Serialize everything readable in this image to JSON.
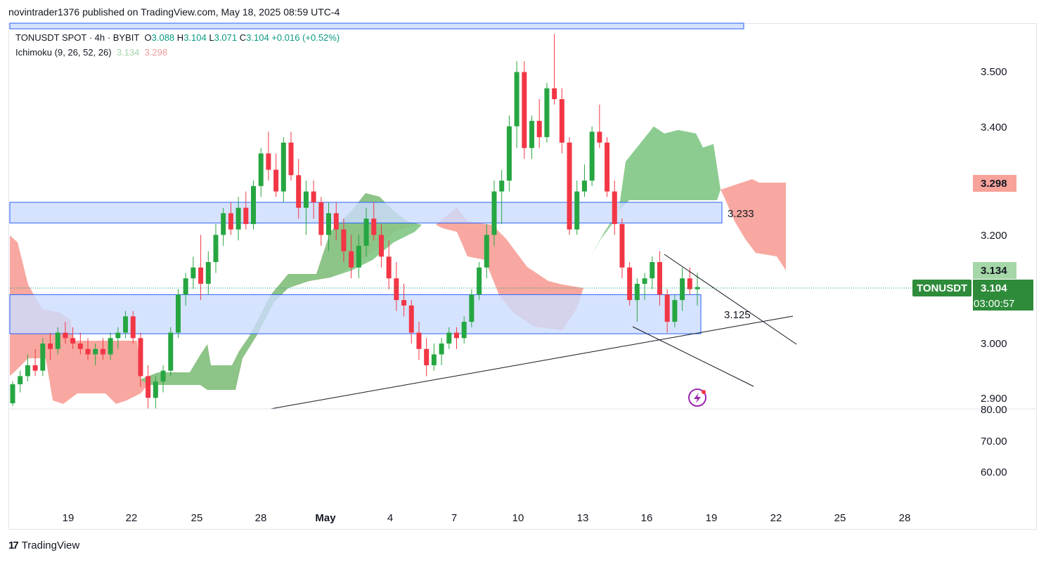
{
  "header": {
    "published": "novintrader1376 published on TradingView.com, May 18, 2025 08:59 UTC-4"
  },
  "legend": {
    "symbol": "TONUSDT SPOT · 4h · BYBIT",
    "o_label": "O",
    "o": "3.088",
    "h_label": "H",
    "h": "3.104",
    "l_label": "L",
    "l": "3.071",
    "c_label": "C",
    "c": "3.104",
    "change": "+0.016 (+0.52%)",
    "indicator": "Ichimoku (9, 26, 52, 26)",
    "ind_v1": "3.134",
    "ind_v2": "3.298"
  },
  "footer": {
    "logo_mark": "17",
    "brand": "TradingView"
  },
  "colors": {
    "up": "#089981",
    "down": "#f23645",
    "up_candle": "#26a641",
    "cloud_up": "#81c784",
    "cloud_down": "#f7998f",
    "zone": "#ccdcff",
    "zone_border": "#2962ff"
  },
  "chart_data": {
    "type": "candlestick",
    "symbol": "TONUSDT",
    "timeframe": "4h",
    "exchange": "BYBIT",
    "x_ticks": [
      "19",
      "22",
      "25",
      "28",
      "May",
      "4",
      "7",
      "10",
      "13",
      "16",
      "19",
      "22",
      "25",
      "28"
    ],
    "price_ticks": [
      "3.500",
      "3.400",
      "3.200",
      "3.000",
      "2.900"
    ],
    "lower_ticks": [
      "80.00",
      "70.00",
      "60.00"
    ],
    "last_price": "3.104",
    "last_symbol": "TONUSDT",
    "countdown": "03:00:57",
    "ichimoku_a": "3.134",
    "ichimoku_b": "3.298",
    "annotations": [
      "3.233",
      "3.125"
    ],
    "zones": [
      {
        "top": 3.26,
        "bottom": 3.222
      },
      {
        "top": 3.09,
        "bottom": 3.018
      },
      {
        "top": 3.6,
        "bottom": 3.57
      }
    ],
    "candles_ohlc": [
      [
        2.89,
        2.93,
        2.885,
        2.925
      ],
      [
        2.925,
        2.95,
        2.91,
        2.94
      ],
      [
        2.94,
        2.98,
        2.93,
        2.96
      ],
      [
        2.96,
        2.99,
        2.94,
        2.95
      ],
      [
        2.95,
        3.01,
        2.94,
        3.0
      ],
      [
        3.0,
        3.02,
        2.97,
        2.99
      ],
      [
        2.99,
        3.03,
        2.98,
        3.02
      ],
      [
        3.02,
        3.04,
        3.0,
        3.01
      ],
      [
        3.01,
        3.03,
        2.99,
        3.0
      ],
      [
        3.0,
        3.02,
        2.98,
        2.99
      ],
      [
        2.99,
        3.01,
        2.97,
        2.98
      ],
      [
        2.98,
        3.0,
        2.96,
        2.99
      ],
      [
        2.99,
        3.01,
        2.97,
        2.98
      ],
      [
        2.98,
        3.02,
        2.97,
        3.01
      ],
      [
        3.01,
        3.03,
        2.99,
        3.02
      ],
      [
        3.02,
        3.06,
        3.01,
        3.05
      ],
      [
        3.05,
        3.06,
        3.0,
        3.01
      ],
      [
        3.01,
        3.02,
        2.92,
        2.94
      ],
      [
        2.94,
        2.96,
        2.88,
        2.9
      ],
      [
        2.9,
        2.94,
        2.88,
        2.93
      ],
      [
        2.93,
        2.96,
        2.91,
        2.95
      ],
      [
        2.95,
        3.03,
        2.94,
        3.02
      ],
      [
        3.02,
        3.1,
        3.01,
        3.09
      ],
      [
        3.09,
        3.13,
        3.07,
        3.12
      ],
      [
        3.12,
        3.16,
        3.1,
        3.14
      ],
      [
        3.14,
        3.2,
        3.08,
        3.11
      ],
      [
        3.11,
        3.17,
        3.09,
        3.15
      ],
      [
        3.15,
        3.22,
        3.13,
        3.2
      ],
      [
        3.2,
        3.25,
        3.18,
        3.24
      ],
      [
        3.24,
        3.26,
        3.2,
        3.21
      ],
      [
        3.21,
        3.27,
        3.19,
        3.25
      ],
      [
        3.25,
        3.28,
        3.21,
        3.22
      ],
      [
        3.22,
        3.3,
        3.21,
        3.29
      ],
      [
        3.29,
        3.36,
        3.27,
        3.35
      ],
      [
        3.35,
        3.39,
        3.3,
        3.32
      ],
      [
        3.32,
        3.35,
        3.27,
        3.28
      ],
      [
        3.28,
        3.38,
        3.26,
        3.37
      ],
      [
        3.37,
        3.39,
        3.3,
        3.31
      ],
      [
        3.31,
        3.34,
        3.23,
        3.25
      ],
      [
        3.25,
        3.3,
        3.2,
        3.28
      ],
      [
        3.28,
        3.3,
        3.23,
        3.26
      ],
      [
        3.26,
        3.27,
        3.18,
        3.2
      ],
      [
        3.2,
        3.26,
        3.17,
        3.24
      ],
      [
        3.24,
        3.26,
        3.19,
        3.21
      ],
      [
        3.21,
        3.23,
        3.15,
        3.17
      ],
      [
        3.17,
        3.2,
        3.12,
        3.14
      ],
      [
        3.14,
        3.2,
        3.12,
        3.18
      ],
      [
        3.18,
        3.25,
        3.16,
        3.23
      ],
      [
        3.23,
        3.26,
        3.19,
        3.2
      ],
      [
        3.2,
        3.22,
        3.14,
        3.16
      ],
      [
        3.16,
        3.19,
        3.1,
        3.12
      ],
      [
        3.12,
        3.15,
        3.06,
        3.08
      ],
      [
        3.08,
        3.11,
        3.05,
        3.07
      ],
      [
        3.07,
        3.08,
        3.0,
        3.02
      ],
      [
        3.02,
        3.04,
        2.97,
        2.99
      ],
      [
        2.99,
        3.01,
        2.94,
        2.96
      ],
      [
        2.96,
        3.0,
        2.95,
        2.98
      ],
      [
        2.98,
        3.01,
        2.96,
        3.0
      ],
      [
        3.0,
        3.03,
        2.99,
        3.02
      ],
      [
        3.02,
        3.03,
        2.99,
        3.01
      ],
      [
        3.01,
        3.05,
        3.0,
        3.04
      ],
      [
        3.04,
        3.1,
        3.03,
        3.09
      ],
      [
        3.09,
        3.15,
        3.08,
        3.14
      ],
      [
        3.14,
        3.22,
        3.12,
        3.2
      ],
      [
        3.2,
        3.3,
        3.18,
        3.28
      ],
      [
        3.28,
        3.32,
        3.22,
        3.3
      ],
      [
        3.3,
        3.42,
        3.28,
        3.4
      ],
      [
        3.4,
        3.52,
        3.36,
        3.5
      ],
      [
        3.5,
        3.52,
        3.34,
        3.36
      ],
      [
        3.36,
        3.42,
        3.34,
        3.41
      ],
      [
        3.41,
        3.45,
        3.36,
        3.38
      ],
      [
        3.38,
        3.48,
        3.37,
        3.47
      ],
      [
        3.47,
        3.57,
        3.44,
        3.45
      ],
      [
        3.45,
        3.47,
        3.35,
        3.37
      ],
      [
        3.37,
        3.38,
        3.2,
        3.21
      ],
      [
        3.21,
        3.3,
        3.2,
        3.28
      ],
      [
        3.28,
        3.33,
        3.27,
        3.3
      ],
      [
        3.3,
        3.4,
        3.29,
        3.39
      ],
      [
        3.39,
        3.44,
        3.36,
        3.37
      ],
      [
        3.37,
        3.38,
        3.27,
        3.28
      ],
      [
        3.28,
        3.3,
        3.2,
        3.22
      ],
      [
        3.22,
        3.23,
        3.12,
        3.14
      ],
      [
        3.14,
        3.15,
        3.07,
        3.08
      ],
      [
        3.08,
        3.12,
        3.04,
        3.11
      ],
      [
        3.11,
        3.13,
        3.08,
        3.12
      ],
      [
        3.12,
        3.16,
        3.1,
        3.15
      ],
      [
        3.15,
        3.17,
        3.07,
        3.09
      ],
      [
        3.09,
        3.1,
        3.02,
        3.04
      ],
      [
        3.04,
        3.09,
        3.03,
        3.08
      ],
      [
        3.08,
        3.14,
        3.06,
        3.12
      ],
      [
        3.12,
        3.14,
        3.09,
        3.1
      ],
      [
        3.1,
        3.13,
        3.07,
        3.104
      ]
    ],
    "lines": [
      {
        "kind": "trend-support",
        "from": [
          0.26,
          2.89
        ],
        "to": [
          0.76,
          3.05
        ]
      },
      {
        "kind": "channel-upper",
        "from": [
          0.635,
          3.165
        ],
        "to": [
          0.76,
          3.0
        ]
      },
      {
        "kind": "channel-lower",
        "from": [
          0.605,
          3.03
        ],
        "to": [
          0.72,
          2.92
        ]
      }
    ]
  }
}
